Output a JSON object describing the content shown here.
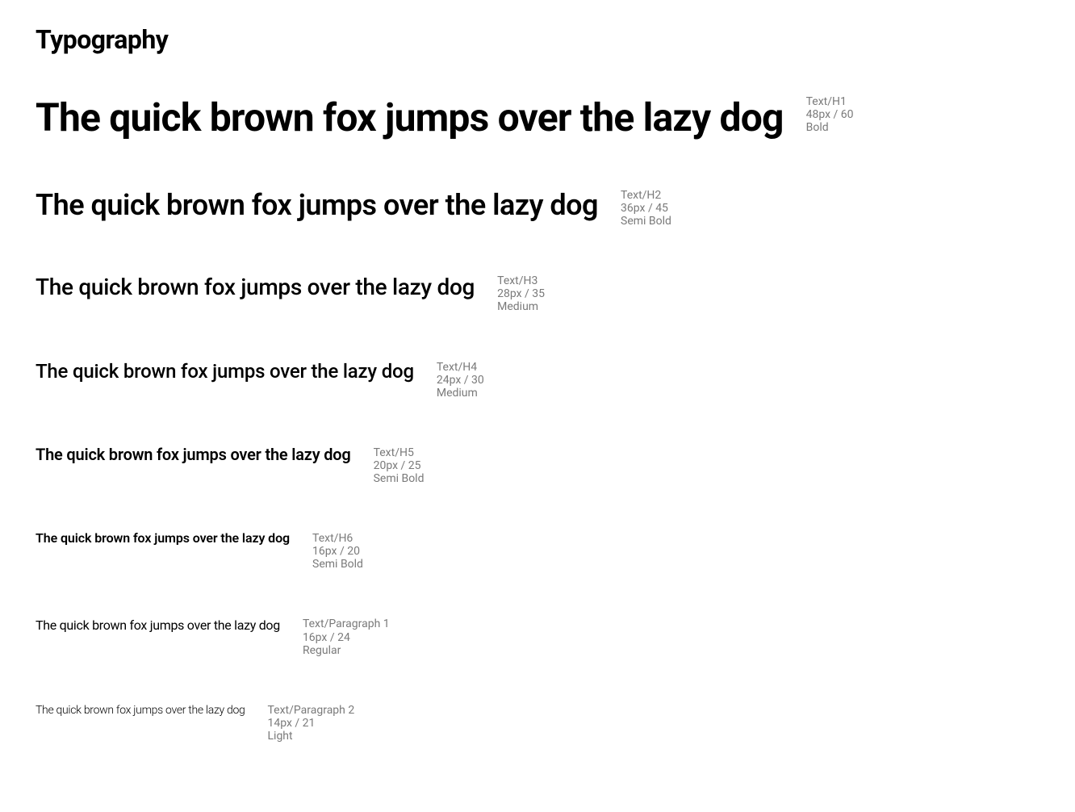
{
  "page_title": "Typography",
  "sample_text": "The quick brown fox jumps over the lazy dog",
  "styles": [
    {
      "name": "Text/H1",
      "size": "48px / 60",
      "weight": "Bold"
    },
    {
      "name": "Text/H2",
      "size": "36px / 45",
      "weight": "Semi Bold"
    },
    {
      "name": "Text/H3",
      "size": "28px / 35",
      "weight": "Medium"
    },
    {
      "name": "Text/H4",
      "size": "24px / 30",
      "weight": "Medium"
    },
    {
      "name": "Text/H5",
      "size": "20px / 25",
      "weight": "Semi Bold"
    },
    {
      "name": "Text/H6",
      "size": "16px / 20",
      "weight": "Semi Bold"
    },
    {
      "name": "Text/Paragraph 1",
      "size": "16px / 24",
      "weight": "Regular"
    },
    {
      "name": "Text/Paragraph 2",
      "size": "14px / 21",
      "weight": "Light"
    }
  ]
}
